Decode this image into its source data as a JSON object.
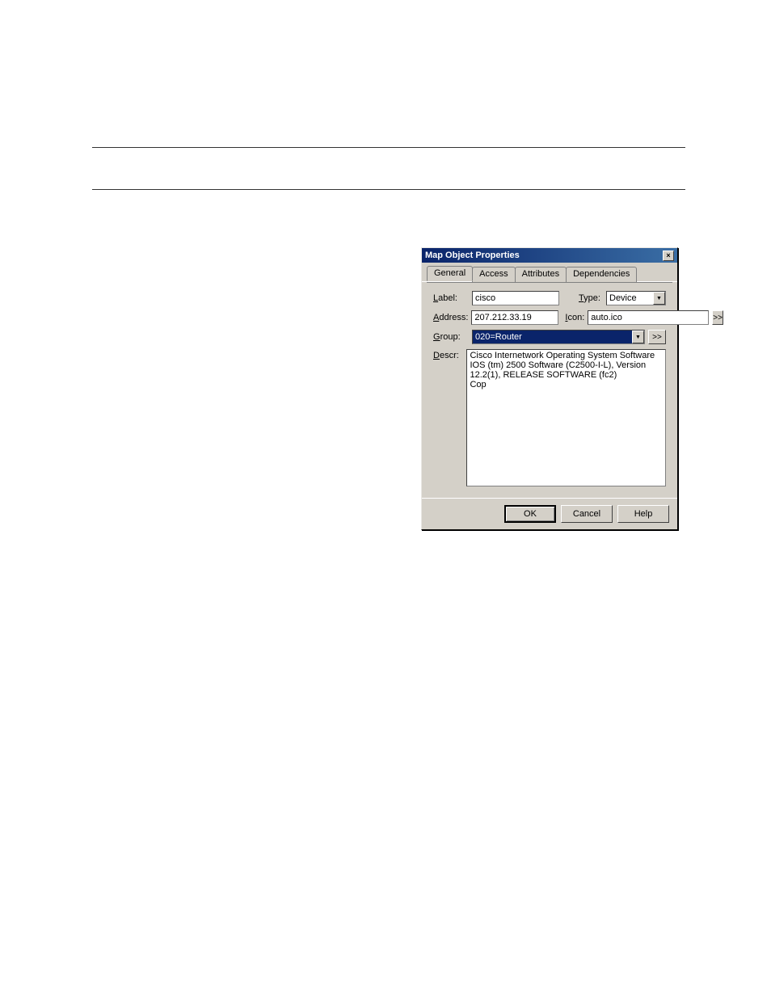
{
  "dialog": {
    "title": "Map Object Properties",
    "close_glyph": "×",
    "tabs": [
      "General",
      "Access",
      "Attributes",
      "Dependencies"
    ],
    "general": {
      "label_label": "Label:",
      "label_value": "cisco",
      "type_label": "Type:",
      "type_value": "Device",
      "address_label": "Address:",
      "address_value": "207.212.33.19",
      "icon_label": "Icon:",
      "icon_value": "auto.ico",
      "icon_more": ">>",
      "group_label": "Group:",
      "group_value": "020=Router",
      "group_more": ">>",
      "descr_label": "Descr:",
      "descr_value": "Cisco Internetwork Operating System Software\nIOS (tm) 2500 Software (C2500-I-L), Version 12.2(1), RELEASE SOFTWARE (fc2)\nCop"
    },
    "buttons": {
      "ok": "OK",
      "cancel": "Cancel",
      "help": "Help"
    }
  }
}
